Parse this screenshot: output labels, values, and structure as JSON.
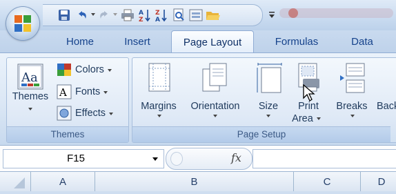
{
  "ribbon_tabs": [
    {
      "label": "Home"
    },
    {
      "label": "Insert"
    },
    {
      "label": "Page Layout",
      "selected": true
    },
    {
      "label": "Formulas"
    },
    {
      "label": "Data"
    }
  ],
  "groups": {
    "themes": {
      "label": "Themes",
      "themes_button": "Themes",
      "colors": "Colors",
      "fonts": "Fonts",
      "effects": "Effects"
    },
    "page_setup": {
      "label": "Page Setup",
      "margins": "Margins",
      "orientation": "Orientation",
      "size": "Size",
      "print_area_line1": "Print",
      "print_area_line2": "Area",
      "breaks": "Breaks",
      "background_partial": "Back"
    }
  },
  "quick_access": {
    "icons": [
      "save-icon",
      "undo-icon",
      "redo-icon",
      "print-icon",
      "sort-ascending-icon",
      "sort-descending-icon",
      "print-preview-icon",
      "form-icon",
      "open-folder-icon",
      "customize-dropdown-icon"
    ]
  },
  "formula_bar": {
    "name_box": "F15",
    "fx_label": "fx",
    "formula_value": ""
  },
  "columns": [
    "A",
    "B",
    "C",
    "D"
  ],
  "colors": {
    "tab_text": "#15428b",
    "ribbon_bg": "#dbe7f5",
    "group_label_bg": "#b3cbe9",
    "office_orange": "#e86a1f"
  }
}
